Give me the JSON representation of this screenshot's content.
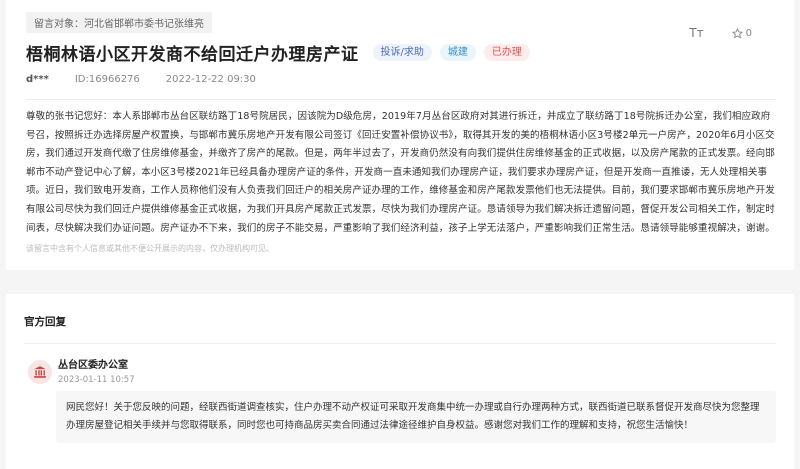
{
  "message": {
    "target_label": "留言对象：河北省邯郸市委书记张维亮",
    "title": "梧桐林语小区开发商不给回迁户办理房产证",
    "tags": [
      "投诉/求助",
      "城建",
      "已办理"
    ],
    "user": "d***",
    "id": "ID:16966276",
    "date": "2022-12-22 09:30",
    "favorite_count": "0",
    "font_tool_label": "Tт",
    "body": "尊敬的张书记您好：本人系邯郸市丛台区联纺路丁18号院居民，因该院为D级危房，2019年7月丛台区政府对其进行拆迁，并成立了联纺路丁18号院拆迁办公室，我们相应政府号召，按照拆迁办选择房屋产权置换，与邯郸市冀乐房地产开发有限公司签订《回迁安置补偿协议书》，取得其开发的美的梧桐林语小区3号楼2单元一户房产，2020年6月小区交房，我们通过开发商代缴了住房维修基金，并缴齐了房产的尾款。但是，两年半过去了，开发商仍然没有向我们提供住房维修基金的正式收据，以及房产尾款的正式发票。经向邯郸市不动产登记中心了解，本小区3号楼2021年已经具备办理房产证的条件，开发商一直未通知我们办理房产证，我们要求办理房产证，但是开发商一直推诿，无人处理相关事项。近日，我们致电开发商，工作人员称他们没有人负责我们回迁户的相关房产证办理的工作，维修基金和房产尾款发票他们也无法提供。目前，我们要求邯郸市冀乐房地产开发有限公司尽快为我们回迁户提供维修基金正式收据，为我们开具房产尾款正式发票，尽快为我们办理房产证。恳请领导为我们解决拆迁遗留问题，督促开发公司相关工作，制定时间表，尽快解决我们办证问题。房产证办不下来，我们的房子不能交易，严重影响了我们经济利益，孩子上学无法落户，严重影响我们正常生活。恳请领导能够重视解决，谢谢。",
    "privacy_note": "该留言中含有个人信息或其他不便公开展示的内容，仅办理机构可见。"
  },
  "reply": {
    "section_title": "官方回复",
    "org": "丛台区委办公室",
    "date": "2023-01-11 10:57",
    "content": "网民您好！关于您反映的问题，经联西街道调查核实，住户办理不动产权证可采取开发商集中统一办理或自行办理两种方式，联西街道已联系督促开发商尽快为您整理办理房屋登记相关手续并与您取得联系，同时您也可持商品房买卖合同通过法律途径维护自身权益。感谢您对我们工作的理解和支持，祝您生活愉快！"
  },
  "colors": {
    "tag_blue": "#4a6db5",
    "tag_cyan": "#3a8fc7",
    "tag_red": "#d9534f",
    "avatar_icon": "#c0504d"
  }
}
